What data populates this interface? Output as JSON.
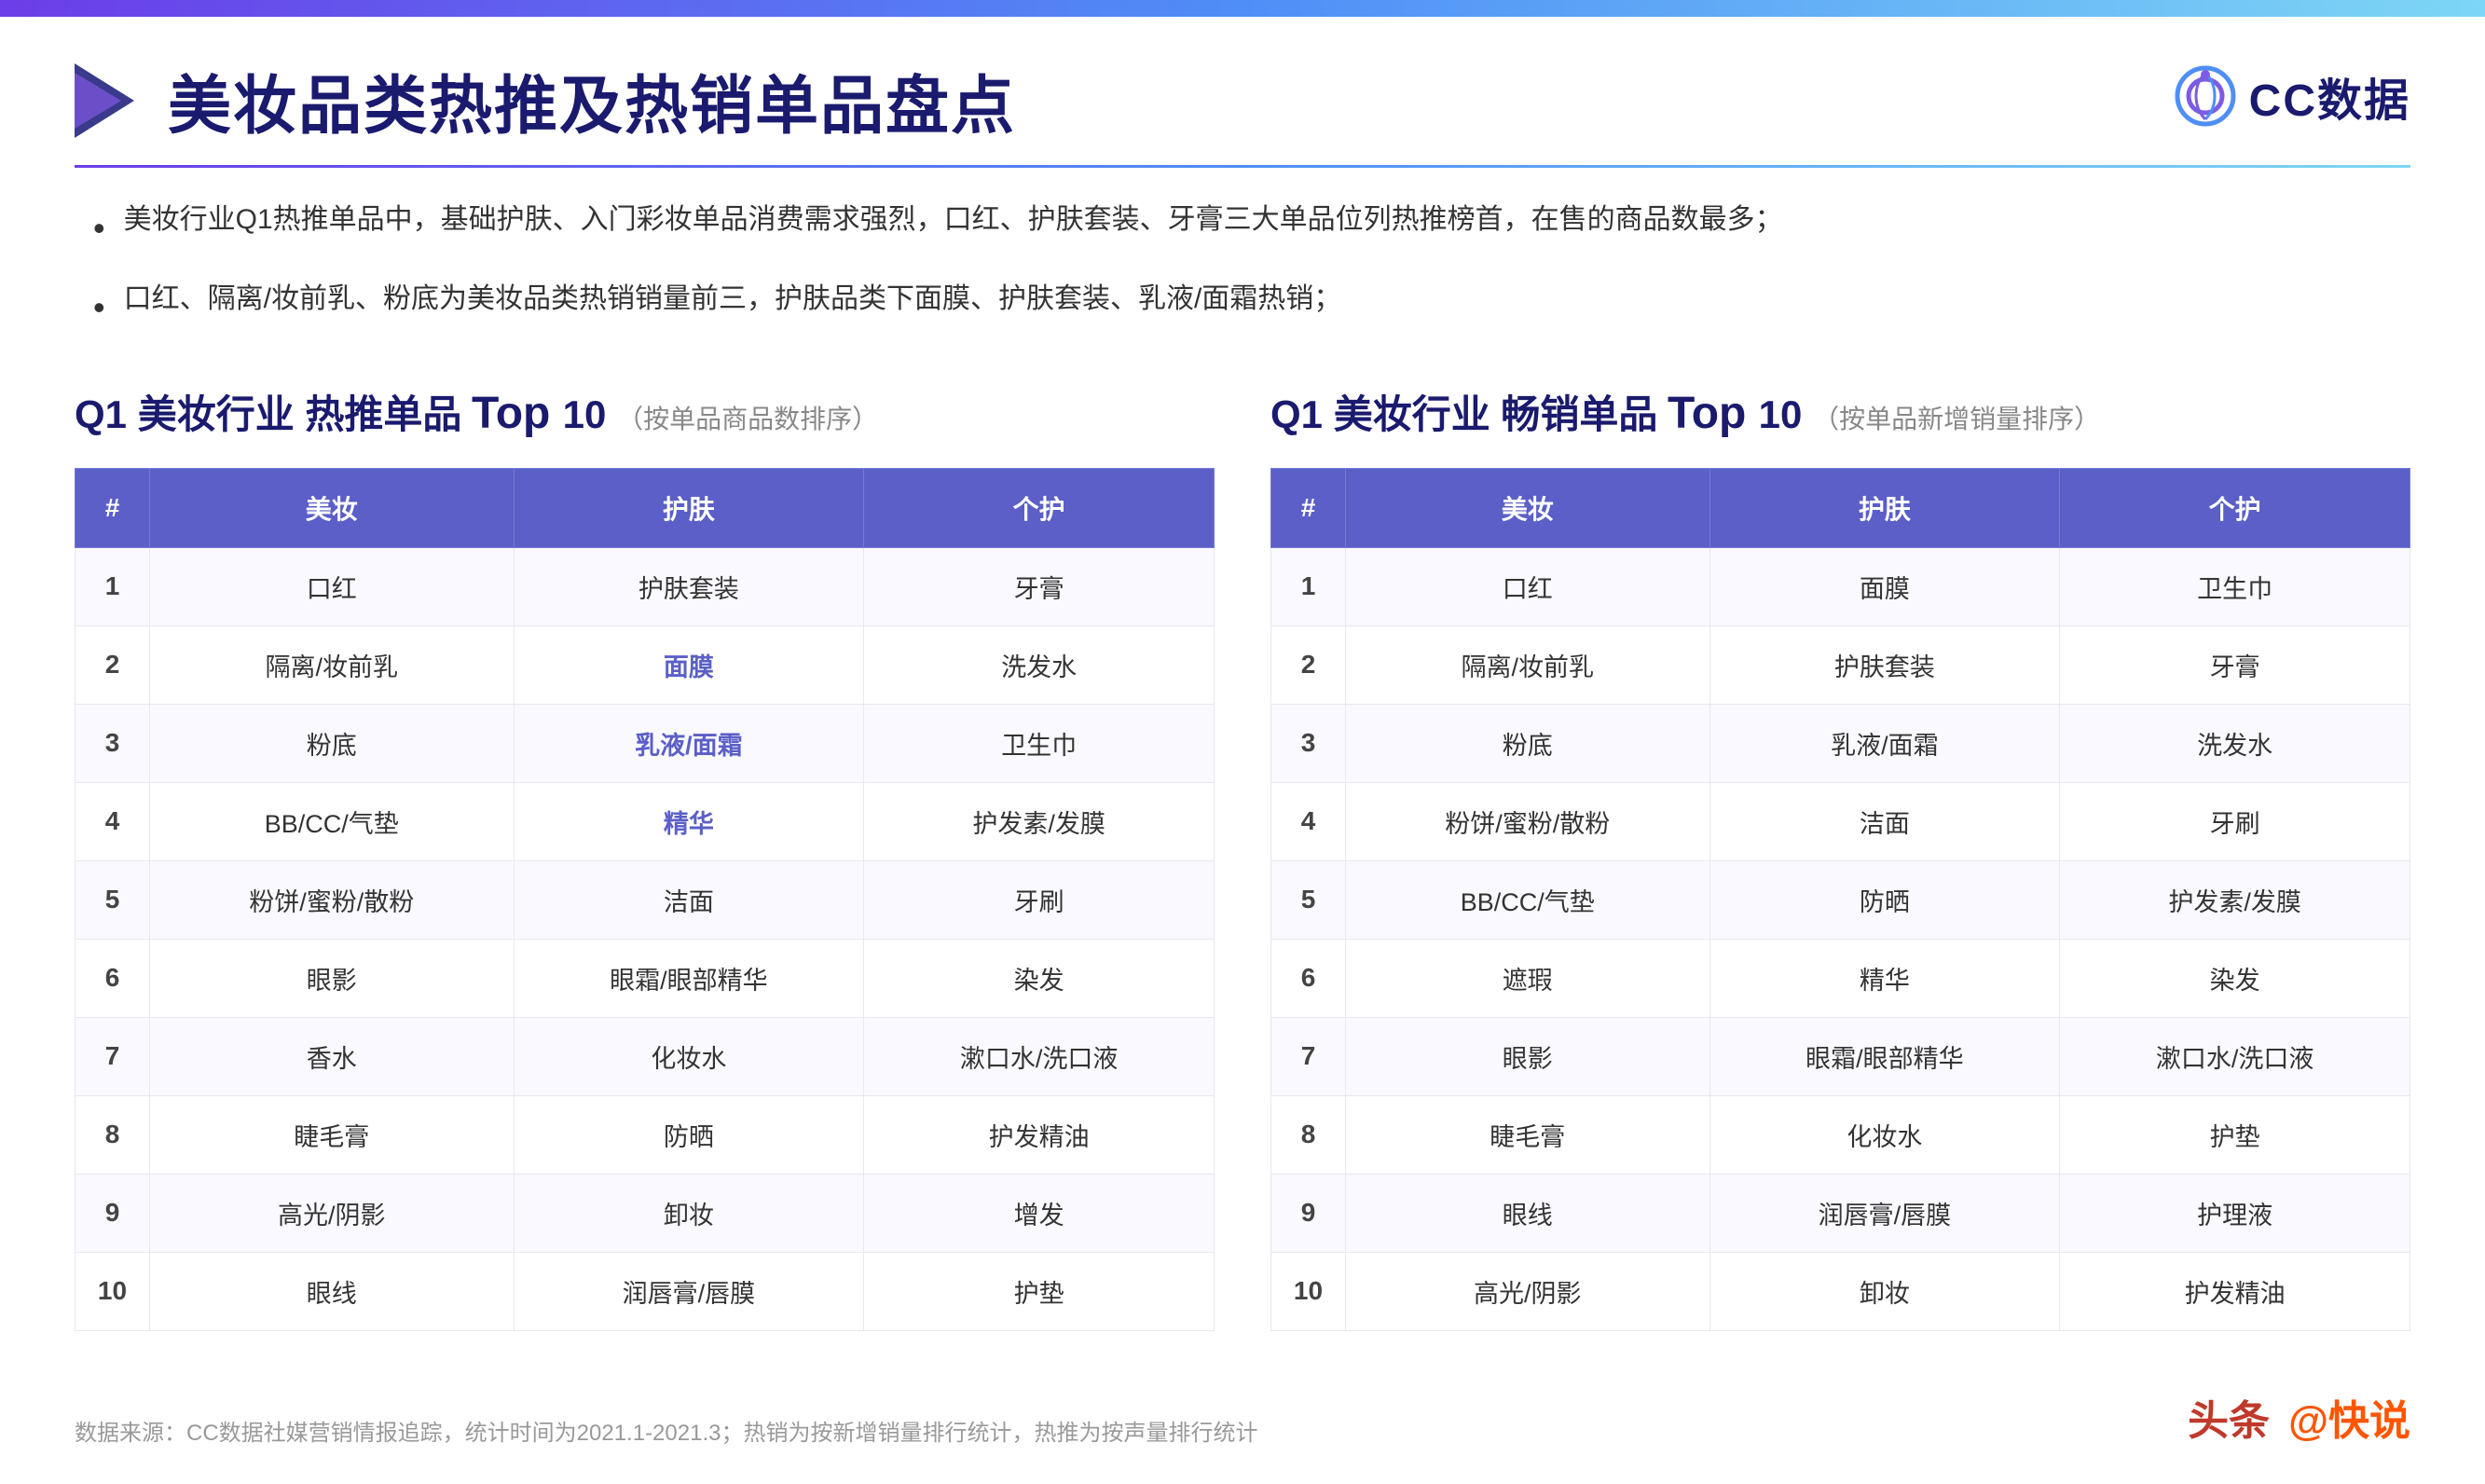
{
  "topBar": {},
  "header": {
    "title": "美妆品类热推及热销单品盘点",
    "logo": "CC数据"
  },
  "bullets": [
    "美妆行业Q1热推单品中，基础护肤、入门彩妆单品消费需求强烈，口红、护肤套装、牙膏三大单品位列热推榜首，在售的商品数最多；",
    "口红、隔离/妆前乳、粉底为美妆品类热销销量前三，护肤品类下面膜、护肤套装、乳液/面霜热销；"
  ],
  "table1": {
    "title_prefix": "Q1 美妆行业 热推单品",
    "title_top": "Top 10",
    "title_suffix": "（按单品商品数排序）",
    "headers": [
      "#",
      "美妆",
      "护肤",
      "个护"
    ],
    "rows": [
      [
        "1",
        "口红",
        "护肤套装",
        "牙膏"
      ],
      [
        "2",
        "隔离/妆前乳",
        "面膜",
        "洗发水"
      ],
      [
        "3",
        "粉底",
        "乳液/面霜",
        "卫生巾"
      ],
      [
        "4",
        "BB/CC/气垫",
        "精华",
        "护发素/发膜"
      ],
      [
        "5",
        "粉饼/蜜粉/散粉",
        "洁面",
        "牙刷"
      ],
      [
        "6",
        "眼影",
        "眼霜/眼部精华",
        "染发"
      ],
      [
        "7",
        "香水",
        "化妆水",
        "漱口水/洗口液"
      ],
      [
        "8",
        "睫毛膏",
        "防晒",
        "护发精油"
      ],
      [
        "9",
        "高光/阴影",
        "卸妆",
        "增发"
      ],
      [
        "10",
        "眼线",
        "润唇膏/唇膜",
        "护垫"
      ]
    ],
    "highlights": [
      [
        2,
        2
      ],
      [
        3,
        2
      ],
      [
        4,
        2
      ]
    ]
  },
  "table2": {
    "title_prefix": "Q1 美妆行业 畅销单品",
    "title_top": "Top 10",
    "title_suffix": "（按单品新增销量排序）",
    "headers": [
      "#",
      "美妆",
      "护肤",
      "个护"
    ],
    "rows": [
      [
        "1",
        "口红",
        "面膜",
        "卫生巾"
      ],
      [
        "2",
        "隔离/妆前乳",
        "护肤套装",
        "牙膏"
      ],
      [
        "3",
        "粉底",
        "乳液/面霜",
        "洗发水"
      ],
      [
        "4",
        "粉饼/蜜粉/散粉",
        "洁面",
        "牙刷"
      ],
      [
        "5",
        "BB/CC/气垫",
        "防晒",
        "护发素/发膜"
      ],
      [
        "6",
        "遮瑕",
        "精华",
        "染发"
      ],
      [
        "7",
        "眼影",
        "眼霜/眼部精华",
        "漱口水/洗口液"
      ],
      [
        "8",
        "睫毛膏",
        "化妆水",
        "护垫"
      ],
      [
        "9",
        "眼线",
        "润唇膏/唇膜",
        "护理液"
      ],
      [
        "10",
        "高光/阴影",
        "卸妆",
        "护发精油"
      ]
    ]
  },
  "footer": {
    "source": "数据来源：CC数据社媒营销情报追踪，统计时间为2021.1-2021.3；热销为按新增销量排行统计，热推为按声量排行统计",
    "logos": [
      "头条",
      "@快说"
    ]
  },
  "watermark": "CC数据"
}
